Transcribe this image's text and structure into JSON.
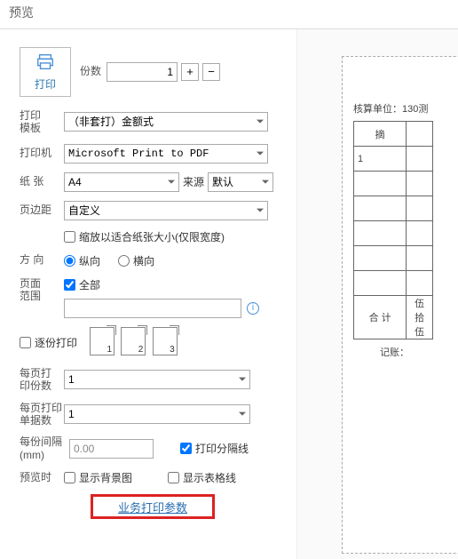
{
  "title": "预览",
  "print_button": "打印",
  "copies_label": "份数",
  "copies_value": "1",
  "template_label": "打印\n模板",
  "template_value": "（非套打）金额式",
  "printer_label": "打印机",
  "printer_value": "Microsoft Print to PDF",
  "paper_label": "纸 张",
  "paper_value": "A4",
  "source_label": "来源",
  "source_value": "默认",
  "margin_label": "页边距",
  "margin_value": "自定义",
  "scale_fit_label": "缩放以适合纸张大小(仅限宽度)",
  "orient_label": "方 向",
  "orient_portrait": "纵向",
  "orient_landscape": "横向",
  "range_label": "页面\n范围",
  "range_all": "全部",
  "collate_label": "逐份打印",
  "collate_page1": "1",
  "collate_page2": "2",
  "collate_page3": "3",
  "per_page_copies_label": "每页打\n印份数",
  "per_page_copies_value": "1",
  "per_page_singles_label": "每页打印\n单据数",
  "per_page_singles_value": "1",
  "interval_label": "每份间隔\n(mm)",
  "interval_value": "0.00",
  "divider_label": "打印分隔线",
  "preview_time_label": "预览时",
  "show_bg_label": "显示背景图",
  "show_grid_label": "显示表格线",
  "biz_button": "业务打印参数",
  "preview": {
    "unit_label": "核算单位：",
    "unit_value": "130测",
    "col1": "摘",
    "rows": [
      "1",
      "",
      "",
      "",
      "",
      ""
    ],
    "total_label": "合 计",
    "total_value": "伍拾伍",
    "footer": "记账："
  }
}
